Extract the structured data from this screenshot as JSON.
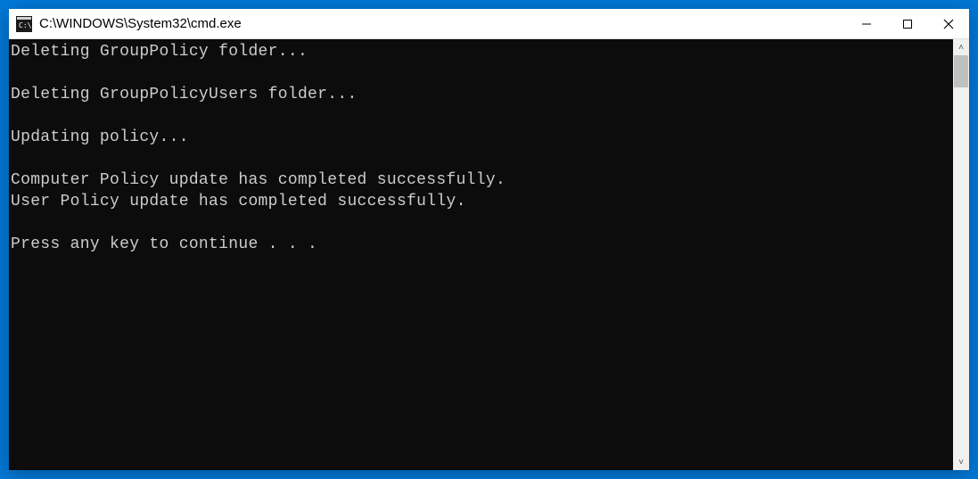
{
  "window": {
    "title": "C:\\WINDOWS\\System32\\cmd.exe"
  },
  "terminal": {
    "lines": [
      "Deleting GroupPolicy folder...",
      "",
      "Deleting GroupPolicyUsers folder...",
      "",
      "Updating policy...",
      "",
      "Computer Policy update has completed successfully.",
      "User Policy update has completed successfully.",
      "",
      "Press any key to continue . . ."
    ]
  }
}
